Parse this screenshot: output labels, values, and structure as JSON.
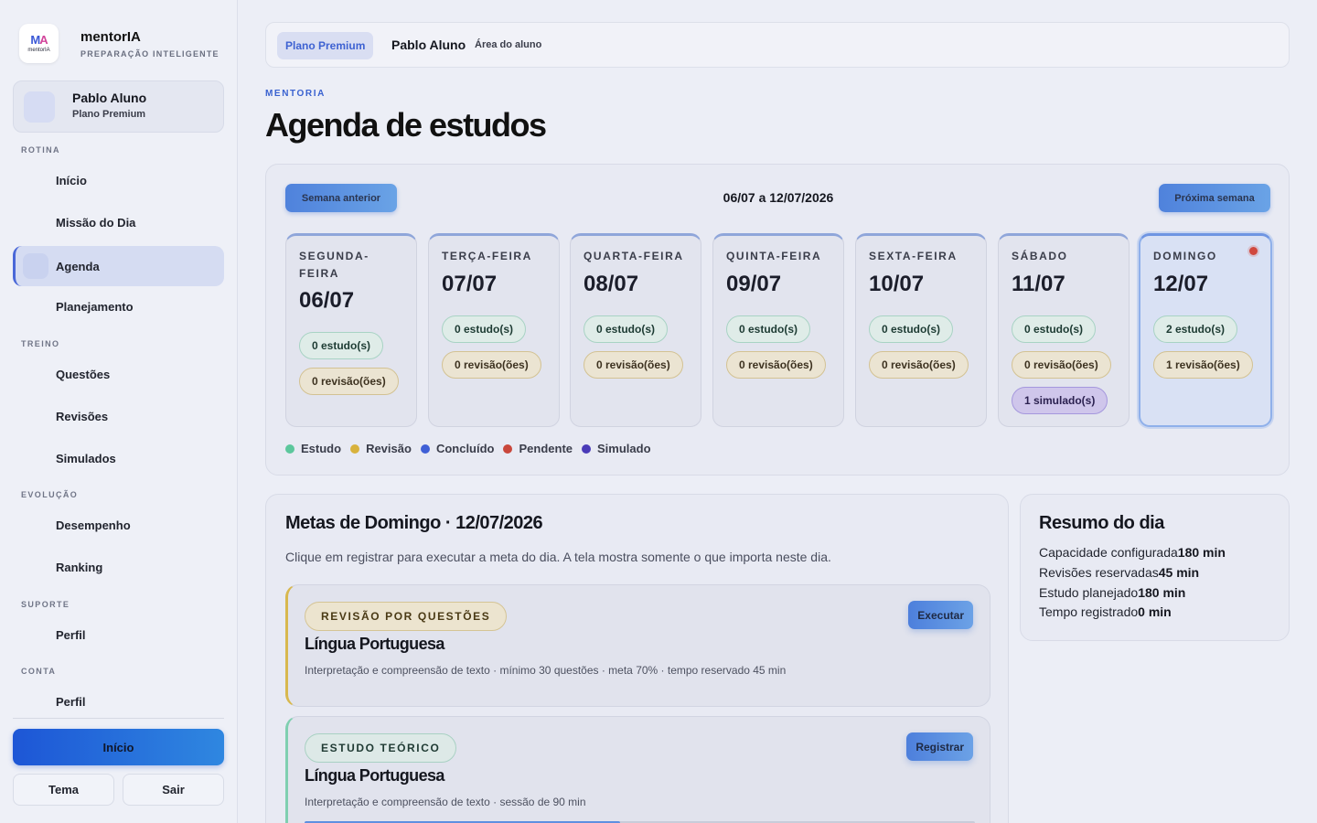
{
  "brand": {
    "name": "mentorIA",
    "subtitle": "PREPARAÇÃO INTELIGENTE",
    "logo_text": "mentorIA"
  },
  "user": {
    "name": "Pablo Aluno",
    "plan": "Plano Premium"
  },
  "sidebar": {
    "sections": [
      {
        "label": "ROTINA",
        "items": [
          "Início",
          "Missão do Dia",
          "Agenda",
          "Planejamento"
        ]
      },
      {
        "label": "TREINO",
        "items": [
          "Questões",
          "Revisões",
          "Simulados"
        ]
      },
      {
        "label": "EVOLUÇÃO",
        "items": [
          "Desempenho",
          "Ranking"
        ]
      },
      {
        "label": "SUPORTE",
        "items": [
          "Perfil"
        ]
      },
      {
        "label": "CONTA",
        "items": [
          "Perfil"
        ]
      }
    ],
    "active_item": "Agenda",
    "primary_button": "Início",
    "theme_button": "Tema",
    "logout_button": "Sair"
  },
  "topbar": {
    "plan_chip": "Plano Premium",
    "user_name": "Pablo Aluno",
    "area_label": "Área do aluno"
  },
  "page": {
    "kicker": "MENTORIA",
    "title": "Agenda de estudos"
  },
  "week": {
    "prev_button": "Semana anterior",
    "next_button": "Próxima semana",
    "range": "06/07 a 12/07/2026",
    "days": [
      {
        "name": "SEGUNDA-FEIRA",
        "date": "06/07",
        "study": "0 estudo(s)",
        "review": "0 revisão(ões)"
      },
      {
        "name": "TERÇA-FEIRA",
        "date": "07/07",
        "study": "0 estudo(s)",
        "review": "0 revisão(ões)"
      },
      {
        "name": "QUARTA-FEIRA",
        "date": "08/07",
        "study": "0 estudo(s)",
        "review": "0 revisão(ões)"
      },
      {
        "name": "QUINTA-FEIRA",
        "date": "09/07",
        "study": "0 estudo(s)",
        "review": "0 revisão(ões)"
      },
      {
        "name": "SEXTA-FEIRA",
        "date": "10/07",
        "study": "0 estudo(s)",
        "review": "0 revisão(ões)"
      },
      {
        "name": "SÁBADO",
        "date": "11/07",
        "study": "0 estudo(s)",
        "review": "0 revisão(ões)",
        "simulado": "1 simulado(s)"
      },
      {
        "name": "DOMINGO",
        "date": "12/07",
        "study": "2 estudo(s)",
        "review": "1 revisão(ões)",
        "pending": true
      }
    ],
    "legend": [
      {
        "label": "Estudo",
        "color": "#5cc79c"
      },
      {
        "label": "Revisão",
        "color": "#d8b23c"
      },
      {
        "label": "Concluído",
        "color": "#3f5fd6"
      },
      {
        "label": "Pendente",
        "color": "#c9473b"
      },
      {
        "label": "Simulado",
        "color": "#4a3bb8"
      }
    ]
  },
  "goals": {
    "title": "Metas de Domingo · 12/07/2026",
    "description": "Clique em registrar para executar a meta do dia. A tela mostra somente o que importa neste dia.",
    "items": [
      {
        "tag": "REVISÃO POR QUESTÕES",
        "subject": "Língua Portuguesa",
        "detail": "Interpretação e compreensão de texto · mínimo 30 questões · meta 70% · tempo reservado 45 min",
        "button": "Executar"
      },
      {
        "tag": "ESTUDO TEÓRICO",
        "subject": "Língua Portuguesa",
        "detail": "Interpretação e compreensão de texto · sessão de 90 min",
        "button": "Registrar",
        "progress": 0.47
      }
    ]
  },
  "summary": {
    "title": "Resumo do dia",
    "rows": [
      {
        "label": "Capacidade configurada",
        "value": "180 min"
      },
      {
        "label": "Revisões reservadas",
        "value": "45 min"
      },
      {
        "label": "Estudo planejado",
        "value": "180 min"
      },
      {
        "label": "Tempo registrado",
        "value": "0 min"
      }
    ]
  }
}
